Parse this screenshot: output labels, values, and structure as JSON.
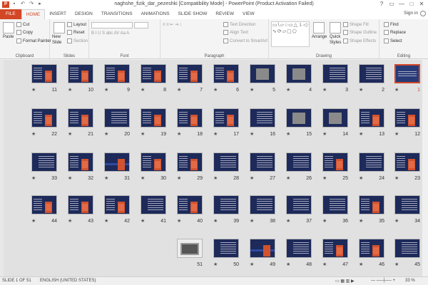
{
  "window": {
    "title": "naghshe_fizik_dar_pezeshki [Compatibility Mode] - PowerPoint (Product Activation Failed)",
    "app_icon": "P",
    "controls": [
      "?",
      "▭",
      "—",
      "□",
      "✕"
    ]
  },
  "quick_access": [
    "save-icon",
    "undo-icon",
    "redo-icon",
    "slideshow-icon"
  ],
  "tabs": [
    {
      "label": "FILE"
    },
    {
      "label": "HOME"
    },
    {
      "label": "INSERT"
    },
    {
      "label": "DESIGN"
    },
    {
      "label": "TRANSITIONS"
    },
    {
      "label": "ANIMATIONS"
    },
    {
      "label": "SLIDE SHOW"
    },
    {
      "label": "REVIEW"
    },
    {
      "label": "VIEW"
    }
  ],
  "account": {
    "signin": "Sign in"
  },
  "ribbon": {
    "clipboard": {
      "label": "Clipboard",
      "paste": "Paste",
      "cut": "Cut",
      "copy": "Copy",
      "format_painter": "Format Painter"
    },
    "slides": {
      "label": "Slides",
      "new_slide": "New",
      "new_slide2": "Slide",
      "layout": "Layout",
      "reset": "Reset",
      "section": "Section"
    },
    "font": {
      "label": "Font"
    },
    "paragraph": {
      "label": "Paragraph",
      "text_direction": "Text Direction",
      "align_text": "Align Text",
      "convert": "Convert to SmartArt"
    },
    "drawing": {
      "label": "Drawing",
      "arrange": "Arrange",
      "quick_styles": "Quick",
      "quick_styles2": "Styles",
      "shape_fill": "Shape Fill",
      "shape_outline": "Shape Outline",
      "shape_effects": "Shape Effects",
      "shapes_glyphs": "▭\\▱○▭△⇂◁☆{}∿⟳▱▢⬠"
    },
    "editing": {
      "label": "Editing",
      "find": "Find",
      "replace": "Replace",
      "select": "Select"
    }
  },
  "slides": [
    {
      "num": "11",
      "kind": "orange"
    },
    {
      "num": "10",
      "kind": "orange"
    },
    {
      "num": "9",
      "kind": "orange"
    },
    {
      "num": "8",
      "kind": "orange"
    },
    {
      "num": "7",
      "kind": "orange"
    },
    {
      "num": "6",
      "kind": "orange"
    },
    {
      "num": "5",
      "kind": "photo"
    },
    {
      "num": "4",
      "kind": "photo"
    },
    {
      "num": "3",
      "kind": "text"
    },
    {
      "num": "2",
      "kind": "text"
    },
    {
      "num": "1",
      "kind": "selected"
    },
    {
      "num": "22",
      "kind": "orange"
    },
    {
      "num": "21",
      "kind": "orange"
    },
    {
      "num": "20",
      "kind": "text"
    },
    {
      "num": "19",
      "kind": "orange"
    },
    {
      "num": "18",
      "kind": "orange"
    },
    {
      "num": "17",
      "kind": "orange"
    },
    {
      "num": "16",
      "kind": "text"
    },
    {
      "num": "15",
      "kind": "photo"
    },
    {
      "num": "14",
      "kind": "photo"
    },
    {
      "num": "13",
      "kind": "orange"
    },
    {
      "num": "12",
      "kind": "orange"
    },
    {
      "num": "33",
      "kind": "text"
    },
    {
      "num": "32",
      "kind": "orange"
    },
    {
      "num": "31",
      "kind": "band"
    },
    {
      "num": "30",
      "kind": "orange"
    },
    {
      "num": "29",
      "kind": "orange"
    },
    {
      "num": "28",
      "kind": "text"
    },
    {
      "num": "27",
      "kind": "text"
    },
    {
      "num": "26",
      "kind": "text"
    },
    {
      "num": "25",
      "kind": "orange"
    },
    {
      "num": "24",
      "kind": "text"
    },
    {
      "num": "23",
      "kind": "orange"
    },
    {
      "num": "44",
      "kind": "orange"
    },
    {
      "num": "43",
      "kind": "orange"
    },
    {
      "num": "42",
      "kind": "orange"
    },
    {
      "num": "41",
      "kind": "text"
    },
    {
      "num": "40",
      "kind": "orange"
    },
    {
      "num": "39",
      "kind": "text"
    },
    {
      "num": "38",
      "kind": "text"
    },
    {
      "num": "37",
      "kind": "text"
    },
    {
      "num": "36",
      "kind": "text"
    },
    {
      "num": "35",
      "kind": "orange"
    },
    {
      "num": "34",
      "kind": "text"
    },
    {
      "num": "51",
      "kind": "white"
    },
    {
      "num": "50",
      "kind": "text"
    },
    {
      "num": "49",
      "kind": "band"
    },
    {
      "num": "48",
      "kind": "text"
    },
    {
      "num": "47",
      "kind": "orange"
    },
    {
      "num": "46",
      "kind": "orange"
    },
    {
      "num": "45",
      "kind": "text"
    }
  ],
  "status": {
    "slide": "SLIDE 1 OF 51",
    "language": "ENGLISH (UNITED STATES)",
    "zoom": "33 %"
  }
}
